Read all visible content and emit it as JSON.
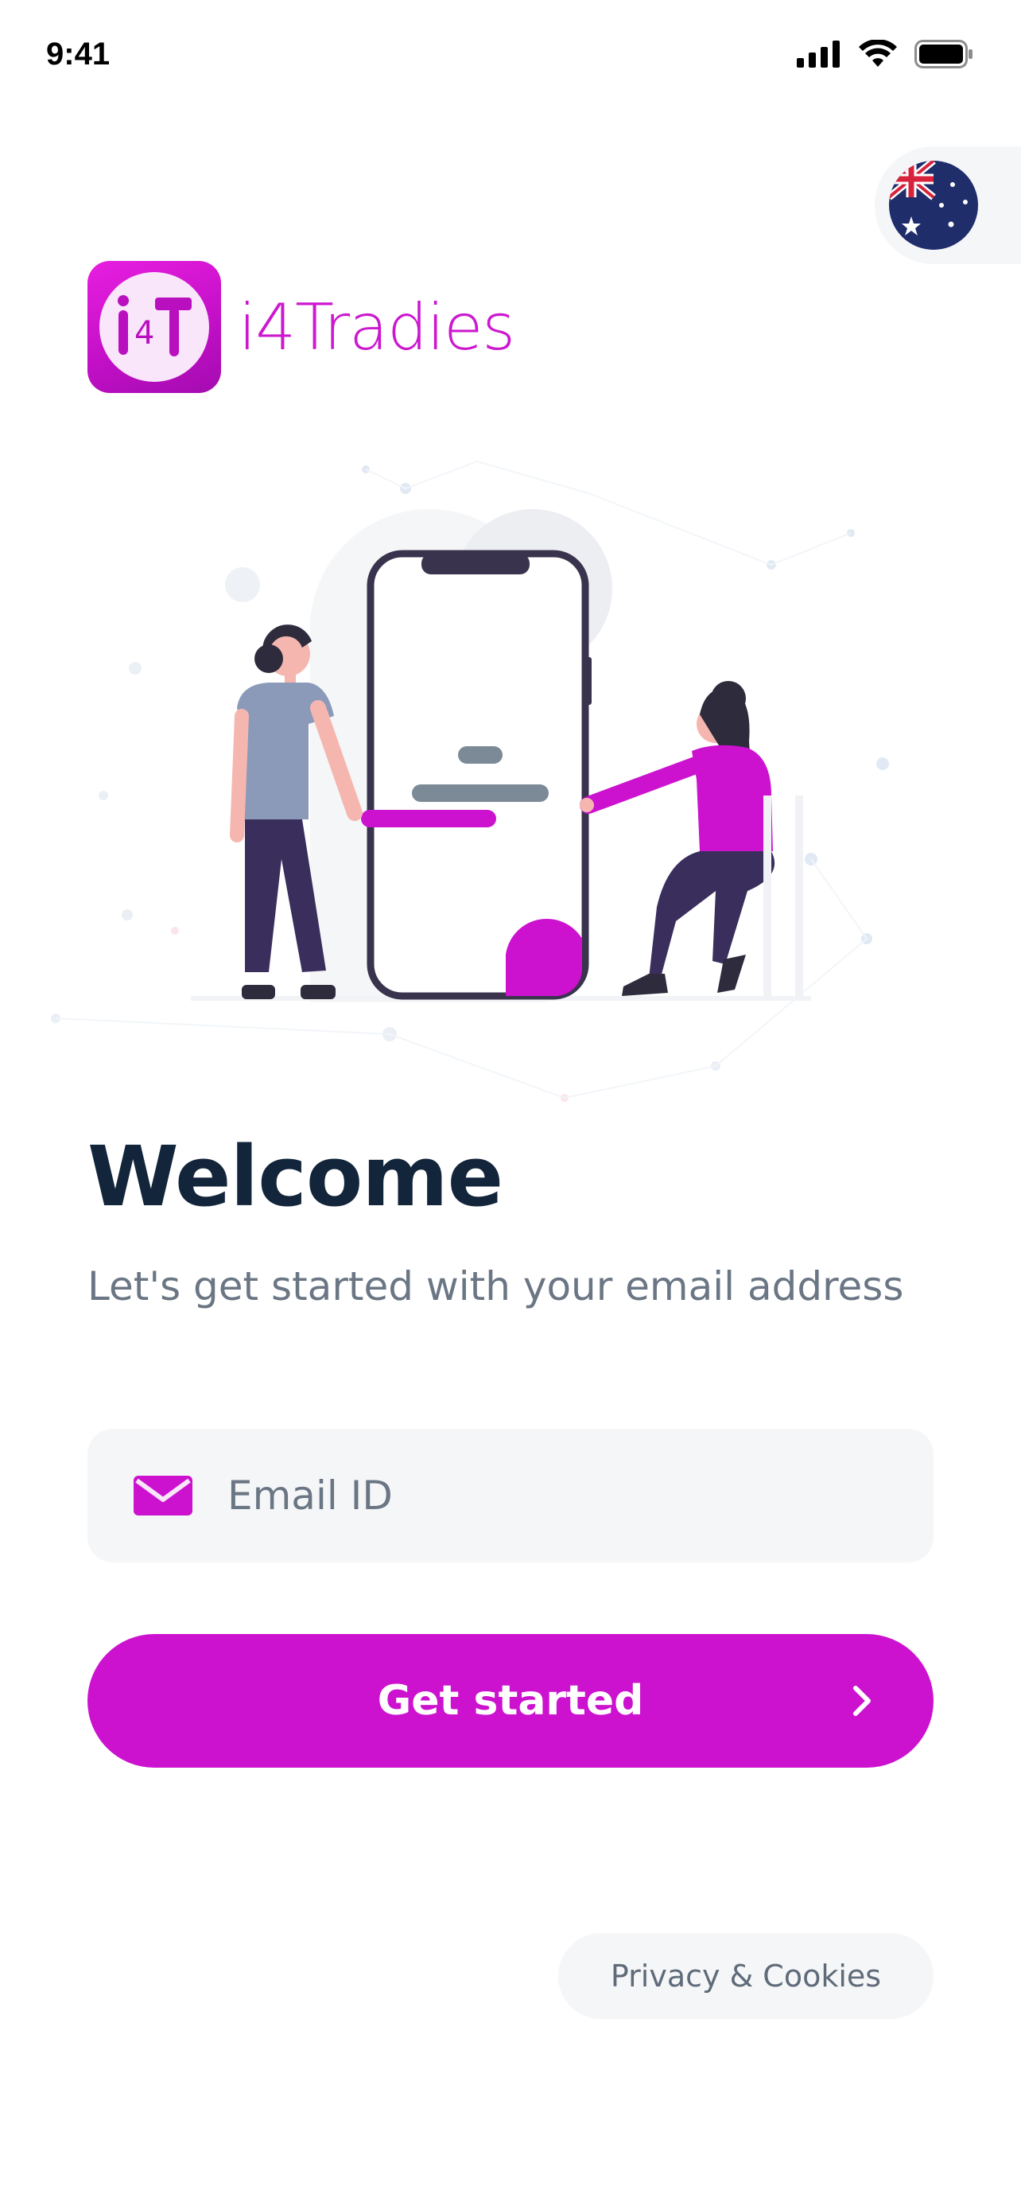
{
  "status_bar": {
    "time": "9:41"
  },
  "brand": {
    "name": "i4Tradies",
    "logo_mark": "i4T",
    "color": "#cc17cf"
  },
  "region": {
    "flag": "australia-flag-icon"
  },
  "welcome": {
    "title": "Welcome",
    "subtitle": "Let's get started with your email address"
  },
  "email": {
    "placeholder": "Email ID",
    "value": ""
  },
  "cta": {
    "label": "Get started"
  },
  "footer": {
    "privacy_label": "Privacy & Cookies"
  },
  "colors": {
    "accent": "#cc12cf",
    "title": "#13253a",
    "muted": "#6b7684",
    "field_bg": "#f5f6f8"
  }
}
